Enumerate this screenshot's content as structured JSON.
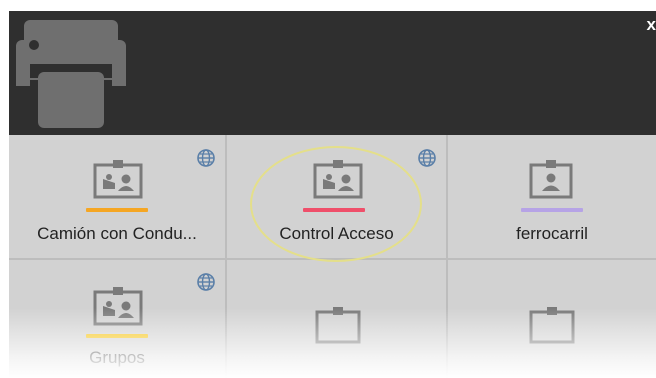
{
  "header": {
    "close_label": "x",
    "printer_icon": "printer-icon",
    "background": "#2f2f2f"
  },
  "tiles": [
    {
      "label": "Camión con Condu...",
      "bar_color": "#f5a623",
      "icon": "id-card-icon",
      "globe": true
    },
    {
      "label": "Control Acceso",
      "bar_color": "#ef4f6a",
      "icon": "id-card-icon",
      "globe": true
    },
    {
      "label": "ferrocarril",
      "bar_color": "#b6a3e6",
      "icon": "id-badge-icon",
      "globe": false
    },
    {
      "label": "Grupos",
      "bar_color": "#f5c518",
      "icon": "id-card-icon",
      "globe": true
    },
    {
      "label": "",
      "bar_color": "",
      "icon": "blank-card-icon",
      "globe": false
    },
    {
      "label": "",
      "bar_color": "",
      "icon": "blank-card-icon",
      "globe": false
    }
  ],
  "colors": {
    "highlight_ellipse": "#e4df8a",
    "globe": "#5a7fa8"
  }
}
